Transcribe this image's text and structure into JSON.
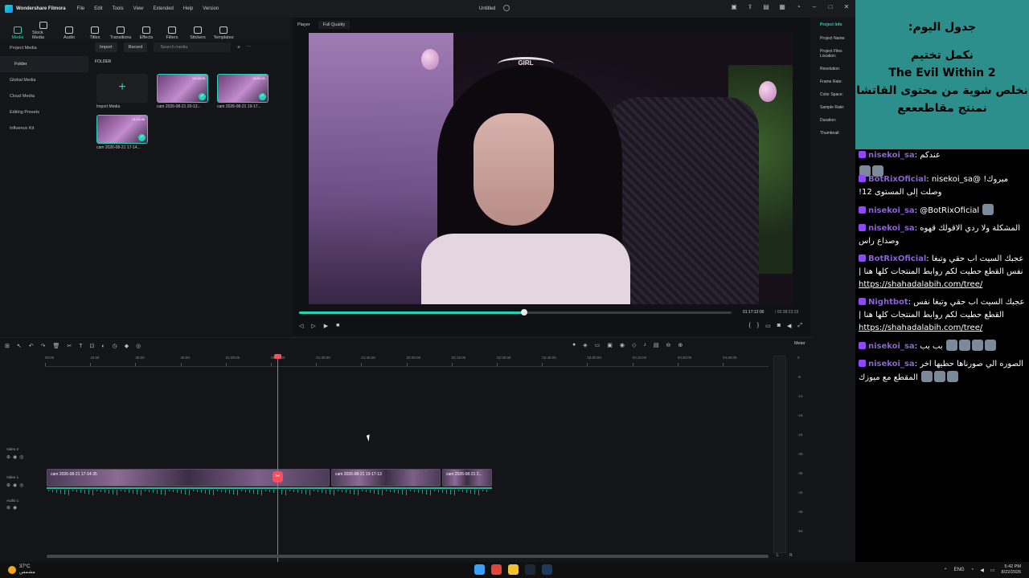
{
  "titlebar": {
    "app_name": "Wondershare Filmora",
    "menu": [
      "File",
      "Edit",
      "Tools",
      "View",
      "Extended",
      "Help",
      "Version"
    ],
    "document": "Untitled"
  },
  "toolbar": {
    "items": [
      "Media",
      "Stock Media",
      "Audio",
      "Titles",
      "Transitions",
      "Effects",
      "Filters",
      "Stickers",
      "Templates"
    ],
    "active": "Media"
  },
  "leftnav": {
    "items": [
      "Project Media",
      "Folder",
      "Global Media",
      "Cloud Media",
      "Editing Presets",
      "Influence Kit"
    ]
  },
  "media": {
    "import_label": "Import",
    "record_label": "Record",
    "search_placeholder": "Search media",
    "folder_label": "FOLDER",
    "import_media_label": "Import Media",
    "clips": [
      {
        "duration": "00:18:05",
        "name": "cam 2026-08-21 20-13..."
      },
      {
        "duration": "00:51:31",
        "name": "cam 2026-08-21 19-17..."
      },
      {
        "duration": "01:24:46",
        "name": "cam 2026-08-21 17-14..."
      }
    ]
  },
  "player": {
    "label": "Player",
    "quality": "Full Quality",
    "current_time": "01:17:12:00",
    "total_time": "/ 02:28:23:19",
    "progress": 0.52,
    "tiara_text": "GIRL"
  },
  "project_info": {
    "title": "Project Info",
    "rows": [
      "Project Name:",
      "Project Files Location:",
      "Resolution:",
      "Frame Rate:",
      "Color Space:",
      "Sample Rate:",
      "Duration:",
      "Thumbnail:"
    ]
  },
  "timeline": {
    "meter_label": "Meter",
    "ruler_ticks": [
      "00:00",
      "15:00",
      "30:00",
      "45:00",
      "01:00:00",
      "01:15:00",
      "01:30:00",
      "01:45:00",
      "02:00:00",
      "02:15:00",
      "02:30:00",
      "02:45:00",
      "03:00:00",
      "03:15:00",
      "03:30:00",
      "03:45:00"
    ],
    "track_labels": {
      "video2": "Video 2",
      "video1": "Video 1",
      "audio1": "Audio 1"
    },
    "clips": [
      {
        "name": "cam 2026-08-21 17-14-35"
      },
      {
        "name": "cam 2026-08-21 19-17-13"
      },
      {
        "name": "cam 2026-08-21 2..."
      }
    ],
    "db_scale": [
      "0",
      "-6",
      "-12",
      "-18",
      "-24",
      "-30",
      "-36",
      "-42",
      "-48",
      "-54"
    ],
    "lr": "L R"
  },
  "stream": {
    "overlay_heading": "جدول اليوم:",
    "overlay_lines": [
      "نكمل تختيم",
      "The Evil Within 2",
      "نخلص شوية من محتوى القاتشا",
      "نمنتج مقاطعععع"
    ],
    "chat": [
      {
        "user": "nisekoi_sa",
        "text": "عندكم"
      },
      {
        "user": "BotRixOficial",
        "text": "مبروك! @nisekoi_sa وصلت إلى المستوى 12!"
      },
      {
        "user": "nisekoi_sa",
        "text": "@BotRixOficial"
      },
      {
        "user": "nisekoi_sa",
        "text": "المشكلة ولا ردي الاقولك قهوه وصداع راس"
      },
      {
        "user": "BotRixOficial",
        "text": "عجبك السيت اب حقي وتبغا نفس القطع حطيت لكم روابط المنتجات كلها هنا |",
        "link": "https://shahadalabih.com/tree/"
      },
      {
        "user": "Nightbot",
        "text": "عجبك السيت اب حقي وتبغا نفس القطع حطيت لكم روابط المنتجات كلها هنا |",
        "link": "https://shahadalabih.com/tree/"
      },
      {
        "user": "nisekoi_sa",
        "text": "بب بب"
      },
      {
        "user": "nisekoi_sa",
        "text": "الصوره الي صورناها حطيها اخر المقطع مع ميوزك"
      }
    ]
  },
  "taskbar": {
    "temp": "37°C",
    "weather_desc": "مشمس",
    "lang": "ENG",
    "time": "5:42 PM",
    "date": "8/22/2026"
  },
  "colors": {
    "accent": "#25d3b5",
    "playhead": "#ff4d5e",
    "overlay_bg": "#2c8f8c",
    "chat_user": "#8a63d2"
  }
}
